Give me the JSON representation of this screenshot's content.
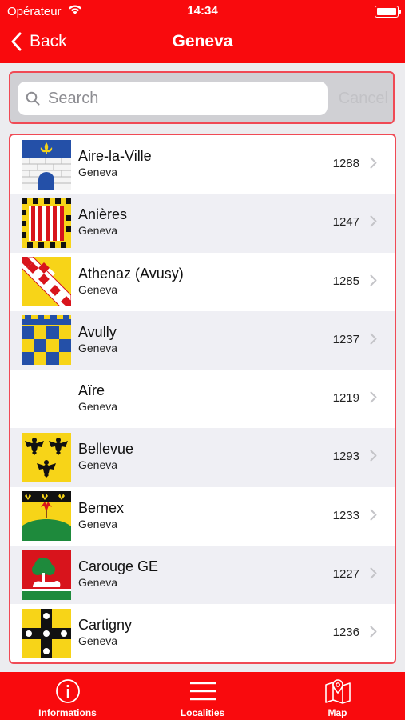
{
  "status_bar": {
    "carrier": "Opérateur",
    "time": "14:34"
  },
  "nav": {
    "back_label": "Back",
    "title": "Geneva"
  },
  "search": {
    "placeholder": "Search",
    "cancel_label": "Cancel"
  },
  "localities": [
    {
      "name": "Aire-la-Ville",
      "canton": "Geneva",
      "number": "1288"
    },
    {
      "name": "Anières",
      "canton": "Geneva",
      "number": "1247"
    },
    {
      "name": "Athenaz (Avusy)",
      "canton": "Geneva",
      "number": "1285"
    },
    {
      "name": "Avully",
      "canton": "Geneva",
      "number": "1237"
    },
    {
      "name": "Aïre",
      "canton": "Geneva",
      "number": "1219"
    },
    {
      "name": "Bellevue",
      "canton": "Geneva",
      "number": "1293"
    },
    {
      "name": "Bernex",
      "canton": "Geneva",
      "number": "1233"
    },
    {
      "name": "Carouge GE",
      "canton": "Geneva",
      "number": "1227"
    },
    {
      "name": "Cartigny",
      "canton": "Geneva",
      "number": "1236"
    }
  ],
  "tabs": [
    {
      "label": "Informations",
      "icon": "info-icon"
    },
    {
      "label": "Localities",
      "icon": "list-icon"
    },
    {
      "label": "Map",
      "icon": "map-icon"
    }
  ],
  "colors": {
    "brand_red": "#f90a0d",
    "border_pink": "#f04a55",
    "row_alt": "#efeff4"
  }
}
